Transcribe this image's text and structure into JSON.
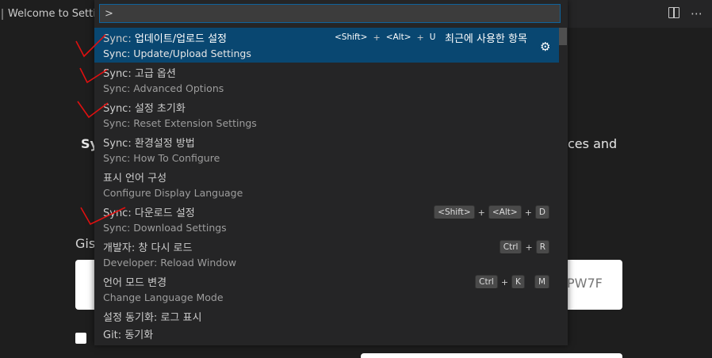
{
  "window": {
    "tab_label": "Welcome to Settings Sync"
  },
  "background": {
    "sync_heading": "Sy",
    "heading_tail": "ces and",
    "gist_label": "Gis",
    "gist_value_tail": "PW7F"
  },
  "quick_input": {
    "value": ">",
    "items": [
      {
        "category": "Sync:",
        "label": "업데이트/업로드 설정",
        "detail": "Sync: Update/Upload Settings",
        "keys": [
          "<Shift>",
          "<Alt>",
          "U"
        ],
        "recent": "최근에 사용한 항목",
        "focused": true
      },
      {
        "category": "Sync:",
        "label": "고급 옵션",
        "detail": "Sync: Advanced Options",
        "keys": []
      },
      {
        "category": "Sync:",
        "label": "설정 초기화",
        "detail": "Sync: Reset Extension Settings",
        "keys": []
      },
      {
        "category": "Sync:",
        "label": "환경설정 방법",
        "detail": "Sync: How To Configure",
        "keys": []
      },
      {
        "category": "",
        "label": "표시 언어 구성",
        "detail": "Configure Display Language",
        "keys": []
      },
      {
        "category": "Sync:",
        "label": "다운로드 설정",
        "detail": "Sync: Download Settings",
        "keys": [
          "<Shift>",
          "<Alt>",
          "D"
        ]
      },
      {
        "category": "개발자:",
        "label": "창 다시 로드",
        "detail": "Developer: Reload Window",
        "keys": [
          "Ctrl",
          "R"
        ]
      },
      {
        "category": "",
        "label": "언어 모드 변경",
        "detail": "Change Language Mode",
        "keys": [
          "Ctrl",
          "K",
          "M"
        ]
      },
      {
        "category": "설정 동기화:",
        "label": "로그 표시",
        "detail": "",
        "keys": []
      },
      {
        "category": "Git:",
        "label": "동기화",
        "detail": "",
        "keys": []
      }
    ]
  }
}
